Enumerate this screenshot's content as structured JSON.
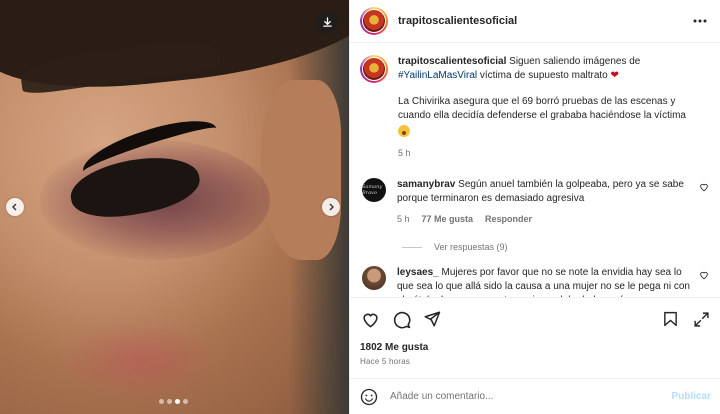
{
  "post": {
    "username": "trapitoscalientesoficial",
    "caption": {
      "text_before": "Siguen saliendo imágenes de ",
      "hashtag": "#YailinLaMasViral",
      "text_after": " víctima de supuesto maltrato ",
      "heart_emoji": "❤",
      "paragraph2": "La Chivirika asegura que el 69 borró pruebas de las escenas y cuando ella decidía defenderse el grababa haciéndose la víctima",
      "time": "5 h"
    },
    "comments": [
      {
        "username": "samanybrav",
        "avatar_text": "Samany Bravo",
        "text": "Según anuel también la golpeaba, pero ya se sabe porque terminaron es demasiado agresiva",
        "time": "5 h",
        "likes": "77 Me gusta",
        "reply": "Responder",
        "view_replies": "Ver respuestas (9)"
      },
      {
        "username": "leysaes_",
        "text": "Mujeres por favor que no se note la envidia hay sea lo que sea lo que allá sido la causa a una mujer no se le pega ni con el pétalo de una rosa entre mujeres debe haber más apoyo"
      }
    ],
    "likes_count": "1802 Me gusta",
    "time_ago": "Hace 5 horas",
    "comment_placeholder": "Añade un comentario...",
    "publish_label": "Publicar",
    "carousel": {
      "count": 4,
      "active": 2
    }
  },
  "colors": {
    "hashtag": "#00376b",
    "muted": "#737373",
    "publish": "#b2dffc",
    "heart": "#d0021b"
  }
}
